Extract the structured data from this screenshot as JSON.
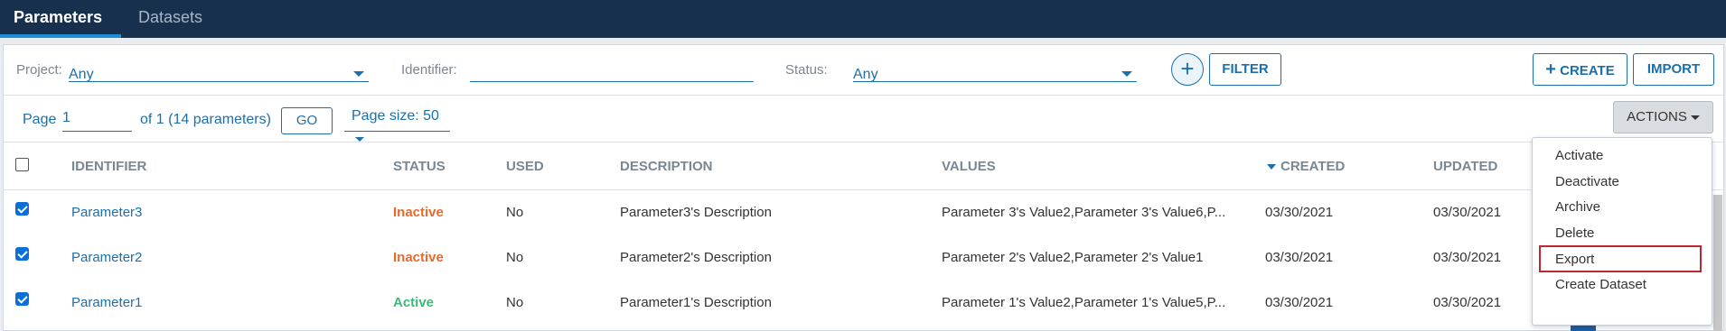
{
  "tabs": [
    {
      "label": "Parameters",
      "active": true
    },
    {
      "label": "Datasets",
      "active": false
    }
  ],
  "filters": {
    "project_label": "Project:",
    "project_value": "Any",
    "identifier_label": "Identifier:",
    "identifier_value": "",
    "status_label": "Status:",
    "status_value": "Any",
    "add_filter_symbol": "+",
    "filter_button": "FILTER",
    "create_button": "CREATE",
    "create_symbol": "+",
    "import_button": "IMPORT"
  },
  "pagination": {
    "page_label": "Page",
    "page_value": "1",
    "of_text": "of 1 (14 parameters)",
    "go_button": "GO",
    "page_size": "Page size: 50",
    "actions_button": "ACTIONS"
  },
  "table": {
    "columns": [
      "IDENTIFIER",
      "STATUS",
      "USED",
      "DESCRIPTION",
      "VALUES",
      "CREATED",
      "UPDATED"
    ],
    "sorted_column": "CREATED",
    "rows": [
      {
        "identifier": "Parameter3",
        "status": "Inactive",
        "used": "No",
        "description": "Parameter3's Description",
        "values": "Parameter 3's Value2,Parameter 3's Value6,P...",
        "created": "03/30/2021",
        "updated": "03/30/2021",
        "checked": true
      },
      {
        "identifier": "Parameter2",
        "status": "Inactive",
        "used": "No",
        "description": "Parameter2's Description",
        "values": "Parameter 2's Value2,Parameter 2's Value1",
        "created": "03/30/2021",
        "updated": "03/30/2021",
        "checked": true
      },
      {
        "identifier": "Parameter1",
        "status": "Active",
        "used": "No",
        "description": "Parameter1's Description",
        "values": "Parameter 1's Value2,Parameter 1's Value5,P...",
        "created": "03/30/2021",
        "updated": "03/30/2021",
        "checked": true
      }
    ]
  },
  "actions_menu": {
    "items": [
      "Activate",
      "Deactivate",
      "Archive",
      "Delete",
      "Export",
      "Create Dataset"
    ],
    "highlighted": "Export"
  },
  "colors": {
    "nav_bg": "#17304d",
    "accent": "#1b6fad",
    "inactive_status": "#e8692a",
    "active_status": "#3cb878",
    "highlight_border": "#c0262d"
  }
}
